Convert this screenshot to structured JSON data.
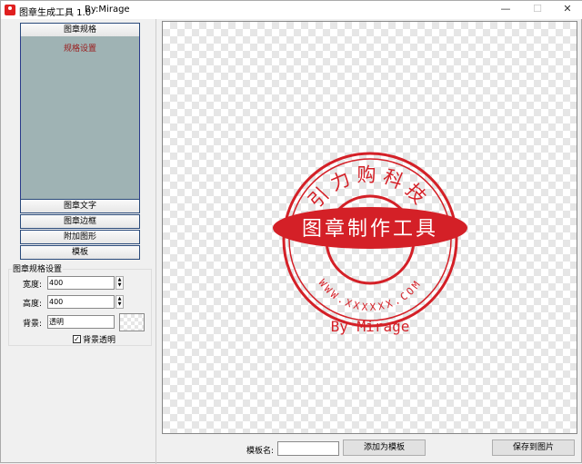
{
  "window": {
    "title": "图章生成工具 1.0",
    "author": "By:Mirage",
    "minimize": "—",
    "maximize": "☐",
    "close": "✕"
  },
  "sidebar": {
    "sections": [
      {
        "label": "图章规格"
      },
      {
        "label": "图章文字"
      },
      {
        "label": "图章边框"
      },
      {
        "label": "附加图形"
      },
      {
        "label": "模板"
      }
    ],
    "active_panel_title": "规格设置"
  },
  "spec": {
    "group_title": "图章规格设置",
    "width_label": "宽度:",
    "width_value": "400",
    "height_label": "高度:",
    "height_value": "400",
    "background_label": "背景:",
    "background_value": "透明",
    "transparent_checkbox_label": "背景透明",
    "transparent_checked": true
  },
  "stamp": {
    "top_text": "引力购科技",
    "band_text": "图章制作工具",
    "bottom_text": "WWW.XXXXXX.COM",
    "signature": "By Mirage",
    "color": "#d42027"
  },
  "footer": {
    "template_name_label": "模板名:",
    "template_name_value": "",
    "add_template_button": "添加为模板",
    "save_image_button": "保存到图片"
  }
}
